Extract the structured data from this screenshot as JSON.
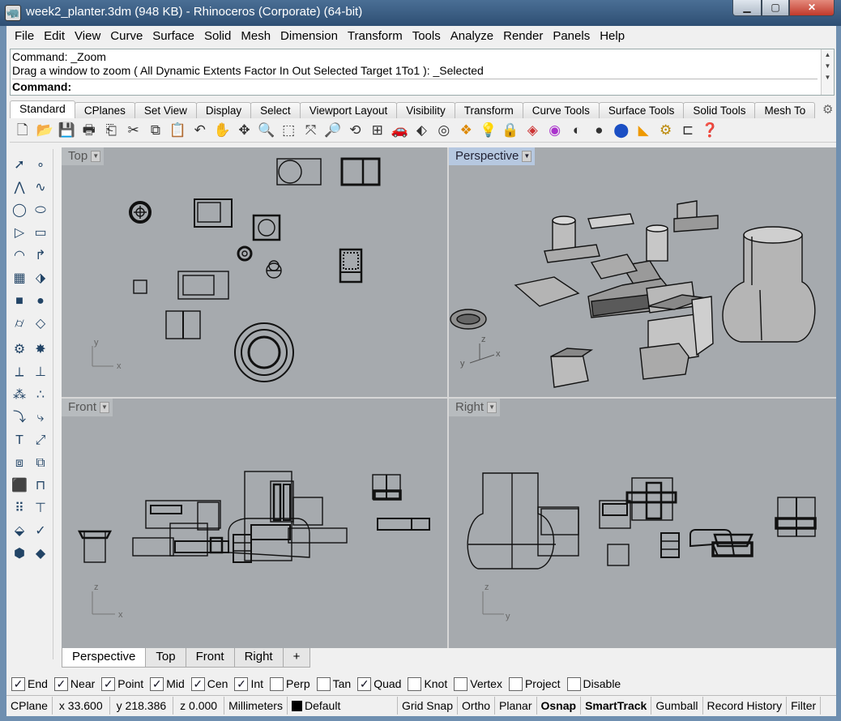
{
  "window": {
    "title": "week2_planter.3dm (948 KB) - Rhinoceros (Corporate) (64-bit)",
    "minimize": "▁",
    "maximize": "▢",
    "close": "✕",
    "app_icon": "rhino-icon",
    "app_glyph": "🦏"
  },
  "menu": [
    "File",
    "Edit",
    "View",
    "Curve",
    "Surface",
    "Solid",
    "Mesh",
    "Dimension",
    "Transform",
    "Tools",
    "Analyze",
    "Render",
    "Panels",
    "Help"
  ],
  "command": {
    "history_1": "Command: _Zoom",
    "history_2": "Drag a window to zoom ( All  Dynamic  Extents  Factor  In  Out  Selected  Target  1To1 ): _Selected",
    "prompt": "Command:"
  },
  "toolbar_tabs": [
    "Standard",
    "CPlanes",
    "Set View",
    "Display",
    "Select",
    "Viewport Layout",
    "Visibility",
    "Transform",
    "Curve Tools",
    "Surface Tools",
    "Solid Tools",
    "Mesh To"
  ],
  "active_toolbar_tab": "Standard",
  "viewports": {
    "top": "Top",
    "perspective": "Perspective",
    "front": "Front",
    "right": "Right",
    "active": "Perspective",
    "axis": {
      "x": "x",
      "y": "y",
      "z": "z"
    }
  },
  "viewport_tabs": [
    "Perspective",
    "Top",
    "Front",
    "Right",
    "+"
  ],
  "active_viewport_tab": "Perspective",
  "osnaps": [
    {
      "label": "End",
      "checked": true
    },
    {
      "label": "Near",
      "checked": true
    },
    {
      "label": "Point",
      "checked": true
    },
    {
      "label": "Mid",
      "checked": true
    },
    {
      "label": "Cen",
      "checked": true
    },
    {
      "label": "Int",
      "checked": true
    },
    {
      "label": "Perp",
      "checked": false
    },
    {
      "label": "Tan",
      "checked": false
    },
    {
      "label": "Quad",
      "checked": true
    },
    {
      "label": "Knot",
      "checked": false
    },
    {
      "label": "Vertex",
      "checked": false
    },
    {
      "label": "Project",
      "checked": false
    },
    {
      "label": "Disable",
      "checked": false
    }
  ],
  "status": {
    "cplane": "CPlane",
    "x": "x 33.600",
    "y": "y 218.386",
    "z": "z 0.000",
    "units": "Millimeters",
    "layer": "Default",
    "layer_color": "#000000",
    "grid_snap": "Grid Snap",
    "ortho": "Ortho",
    "planar": "Planar",
    "osnap": "Osnap",
    "smarttrack": "SmartTrack",
    "gumball": "Gumball",
    "record_history": "Record History",
    "filter": "Filter"
  },
  "colors": {
    "viewport_bg": "#a6aaae",
    "active_viewport_label": "#b6c8e0",
    "titlebar": "#3b5f86"
  }
}
